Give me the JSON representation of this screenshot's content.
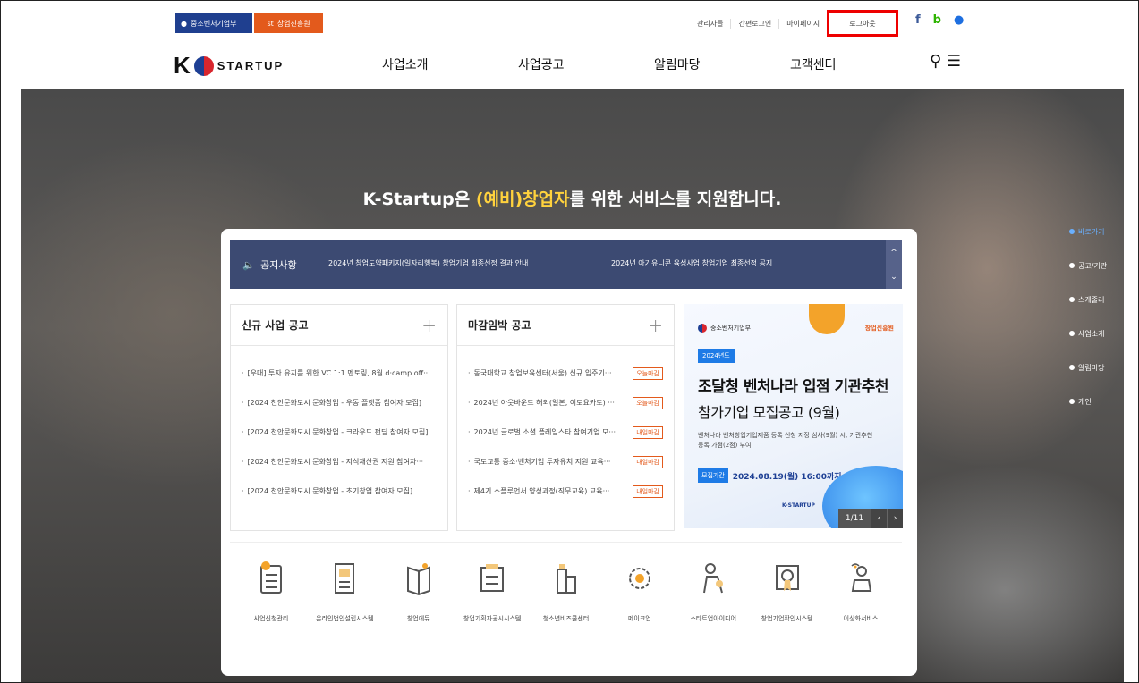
{
  "utilbar": {
    "gov_label": "중소벤처기업부",
    "kised_label": "창업진흥원",
    "links": [
      "관리자들",
      "간편로그인",
      "마이페이지"
    ],
    "logout_label": "로그아웃",
    "icons": [
      "f",
      "b",
      "●"
    ]
  },
  "nav": {
    "logo_text": "STARTUP",
    "items": [
      "사업소개",
      "사업공고",
      "알림마당",
      "고객센터"
    ]
  },
  "hero": {
    "title_pre": "K-Startup은 ",
    "title_highlight": "(예비)창업자",
    "title_post": "를 위한 서비스를 지원합니다."
  },
  "quicknav": [
    "바로가기",
    "공고/기관",
    "스케줄러",
    "사업소개",
    "알림마당",
    "개인"
  ],
  "notice": {
    "label": "공지사항",
    "items": [
      "2024년 창업도약패키지(일자리행복) 창업기업 최종선정 결과 안내",
      "2024년 아기유니콘 육성사업 창업기업 최종선정 공지"
    ]
  },
  "new_announcements": {
    "title": "신규 사업 공고",
    "items": [
      "[우대] 투자 유치를 위한 VC 1:1 멘토링, 8월 d·camp off···",
      "[2024 천안문화도시 문화창업 - 우동 플랫폼 참여자 모집]",
      "[2024 천안문화도시 문화창업 - 크라우드 펀딩 참여자 모집]",
      "[2024 천안문화도시 문화창업 - 지식재산권 지원 참여자···",
      "[2024 천안문화도시 문화창업 - 초기창업 참여자 모집]"
    ]
  },
  "deadline_announcements": {
    "title": "마감임박 공고",
    "items": [
      {
        "text": "동국대학교 창업보육센터(서울) 신규 입주기···",
        "tag": "오늘마감"
      },
      {
        "text": "2024년 아웃바운드 해외(일본, 이토요카도) ···",
        "tag": "오늘마감"
      },
      {
        "text": "2024년 글로벌 소셜 플레잉스타 참여기업 모···",
        "tag": "내일마감"
      },
      {
        "text": "국토교통 중소·벤처기업 투자유치 지원 교육···",
        "tag": "내일마감"
      },
      {
        "text": "제4기 스플루언서 양성과정(직무교육) 교육···",
        "tag": "내일마감"
      }
    ]
  },
  "banner": {
    "org": "중소벤처기업부",
    "kised": "창업진흥원",
    "year_tag": "2024년도",
    "headline1": "조달청 벤처나라 입점 기관추천",
    "headline2": "참가기업 모집공고 (9월)",
    "desc": "벤처나라 벤처창업기업제품 등록 신청 지정 심사(9월) 시, 기관추천 등록 가점(2점) 부여",
    "period_label": "모집기간",
    "period_value": "2024.08.19(월) 16:00까지",
    "logo": "K-STARTUP",
    "pager": "1/11",
    "prev": "‹",
    "next": "›"
  },
  "services": [
    {
      "label": "사업신청관리",
      "icon": "clipboard-check-icon"
    },
    {
      "label": "온라인법인설립시스템",
      "icon": "document-building-icon"
    },
    {
      "label": "창업에듀",
      "icon": "book-icon"
    },
    {
      "label": "창업기획자공시시스템",
      "icon": "board-icon"
    },
    {
      "label": "청소년비즈쿨센터",
      "icon": "building-icon"
    },
    {
      "label": "메이크업",
      "icon": "gear-icon"
    },
    {
      "label": "스타트업아이디어",
      "icon": "idea-hand-icon"
    },
    {
      "label": "창업기업확인시스템",
      "icon": "certificate-icon"
    },
    {
      "label": "이상화서비스",
      "icon": "person-desk-icon"
    }
  ]
}
